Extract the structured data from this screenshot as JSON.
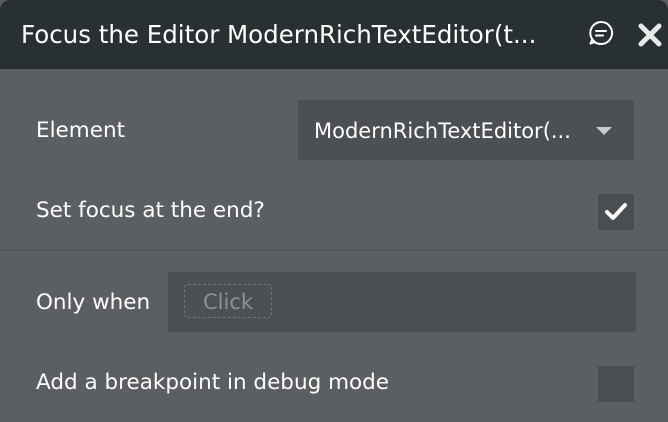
{
  "header": {
    "title": "Focus the Editor ModernRichTextEditor(t...",
    "comment_icon": "comment-icon",
    "close_icon": "close-icon"
  },
  "fields": {
    "element_label": "Element",
    "element_value": "ModernRichTextEditor(...",
    "set_focus_label": "Set focus at the end?",
    "set_focus_checked": true,
    "only_when_label": "Only when",
    "only_when_placeholder": "Click",
    "breakpoint_label": "Add a breakpoint in debug mode",
    "breakpoint_checked": false
  },
  "colors": {
    "header_bg": "#283032",
    "panel_bg": "#5b5f62",
    "field_bg": "#4c5053",
    "text": "#ffffff"
  }
}
